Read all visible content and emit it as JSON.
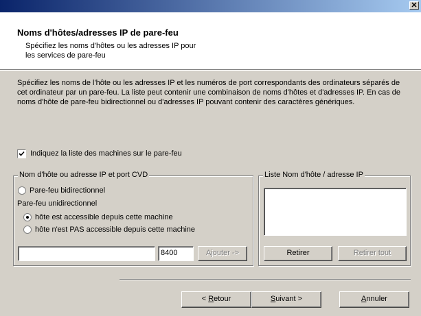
{
  "titlebar": {
    "close_label": "✕"
  },
  "header": {
    "title": "Noms d'hôtes/adresses IP de pare-feu",
    "subtitle": "Spécifiez les noms d'hôtes ou les adresses IP pour les services de pare-feu"
  },
  "description": "Spécifiez les noms de l'hôte ou les adresses IP et les numéros de port correspondants des ordinateurs séparés de cet ordinateur par un pare-feu. La liste peut contenir une combinaison de noms d'hôtes et d'adresses IP. En cas de noms d'hôte de pare-feu bidirectionnel ou d'adresses IP pouvant contenir des caractères génériques.",
  "machine_list_checkbox": {
    "label": "Indiquez la liste des machines sur le pare-feu",
    "checked": true
  },
  "host_group": {
    "label": "Nom d'hôte ou adresse IP et port CVD",
    "bidirectional": {
      "label": "Pare-feu bidirectionnel",
      "selected": false
    },
    "unidirectional_label": "Pare-feu unidirectionnel",
    "accessible": {
      "label": "hôte est accessible depuis cette machine",
      "selected": true
    },
    "not_accessible": {
      "label": "hôte n'est PAS accessible depuis cette machine",
      "selected": false
    },
    "host_input_value": "",
    "port_value": "8400",
    "add_button": "Ajouter ->"
  },
  "list_group": {
    "label": "Liste Nom d'hôte / adresse IP",
    "items": [],
    "remove_button": "Retirer",
    "remove_all_button": "Retirer tout"
  },
  "footer": {
    "back_prefix": "< ",
    "back_mnemonic": "R",
    "back_rest": "etour",
    "next_mnemonic": "S",
    "next_rest": "uivant >",
    "cancel_mnemonic": "A",
    "cancel_rest": "nnuler"
  },
  "colors": {
    "titlebar_start": "#0a246a",
    "titlebar_end": "#a6caf0",
    "dialog_bg": "#d4d0c8"
  }
}
